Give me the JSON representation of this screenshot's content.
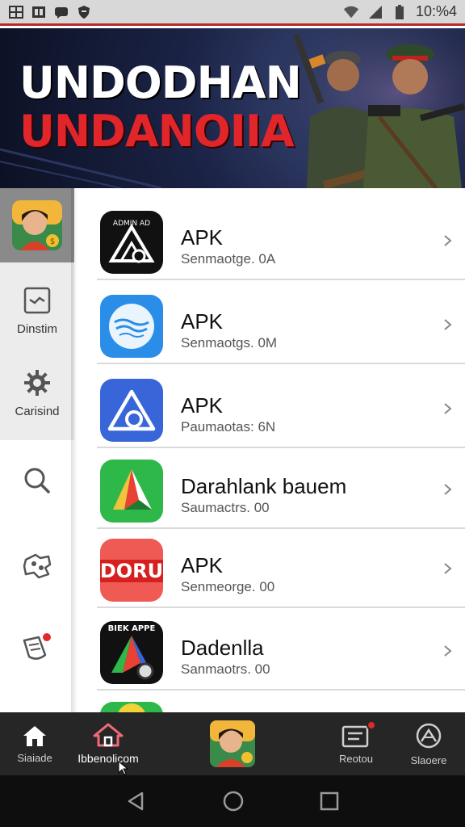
{
  "status_bar": {
    "time": "10:%4",
    "left_icons": [
      "gallery-icon",
      "notification-icon",
      "chat-icon",
      "shield-icon"
    ],
    "right_icons": [
      "wifi-icon",
      "signal-icon",
      "battery-icon"
    ]
  },
  "banner": {
    "title_line_1": "UNDODHAN",
    "title_line_2": "UNDANOIIA"
  },
  "left_rail": {
    "items": [
      {
        "label": "",
        "icon": "avatar-app-icon"
      },
      {
        "label": "Dinstim",
        "icon": "image-frame-icon"
      },
      {
        "label": "Carisind",
        "icon": "gear-icon"
      },
      {
        "label": "",
        "icon": "search-icon"
      },
      {
        "label": "",
        "icon": "puzzle-icon"
      },
      {
        "label": "",
        "icon": "tag-icon"
      }
    ]
  },
  "apps": [
    {
      "title": "APK",
      "subtitle": "Senmaotge. 0A",
      "icon_text": "",
      "icon": "triangle-logo-icon"
    },
    {
      "title": "APK",
      "subtitle": "Senmaotgs. 0M",
      "icon_text": "",
      "icon": "wave-logo-icon"
    },
    {
      "title": "APK",
      "subtitle": "Paumaotas: 6N",
      "icon_text": "",
      "icon": "blue-triangle-icon"
    },
    {
      "title": "Darahlank bauem",
      "subtitle": "Saumactrs. 00",
      "icon_text": "",
      "icon": "green-arrow-icon"
    },
    {
      "title": "APK",
      "subtitle": "Senmeorge. 00",
      "icon_text": "DORU",
      "icon": "doru-logo-icon"
    },
    {
      "title": "Dadenlla",
      "subtitle": "Sanmaotrs. 00",
      "icon_text": "BIEK APPE",
      "icon": "colored-triangle-icon"
    },
    {
      "title": "",
      "subtitle": "",
      "icon_text": "",
      "icon": "green-circle-icon"
    }
  ],
  "bottom_nav": {
    "items": [
      {
        "label": "Siaiade",
        "icon": "home-icon",
        "badge": false
      },
      {
        "label": "Ibbenolicom",
        "icon": "home-outline-icon",
        "badge": false,
        "active": true
      },
      {
        "label": "",
        "icon": "avatar-app-icon",
        "badge": false
      },
      {
        "label": "Reotou",
        "icon": "list-icon",
        "badge": true
      },
      {
        "label": "Slaoere",
        "icon": "compass-icon",
        "badge": false
      }
    ]
  },
  "colors": {
    "accent": "#e0262a",
    "status_bar": "#d8d8d8",
    "nav_bg": "#262626",
    "rail_selected": "#8a8a8a",
    "rail_section": "#ececec"
  }
}
